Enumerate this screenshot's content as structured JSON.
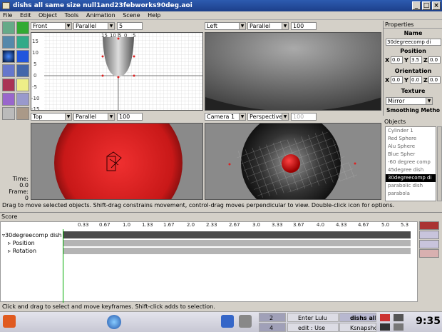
{
  "window": {
    "title": "dishs all same size null1and23febworks90deg.aoi"
  },
  "menu": [
    "File",
    "Edit",
    "Object",
    "Tools",
    "Animation",
    "Scene",
    "Help"
  ],
  "views": [
    {
      "name": "Front",
      "mode": "Parallel",
      "zoom": "5"
    },
    {
      "name": "Left",
      "mode": "Parallel",
      "zoom": "100"
    },
    {
      "name": "Top",
      "mode": "Parallel",
      "zoom": "100"
    },
    {
      "name": "Camera 1",
      "mode": "Perspective",
      "zoom": "100"
    }
  ],
  "ruler": {
    "top": [
      "15",
      "10",
      "5",
      "0",
      "5"
    ],
    "left": [
      "15",
      "10",
      "5",
      "0",
      "-5",
      "-10",
      "-15"
    ]
  },
  "time": {
    "time_label": "Time:",
    "time_value": "0.0",
    "frame_label": "Frame:",
    "frame_value": "0"
  },
  "properties": {
    "title": "Properties",
    "name_label": "Name",
    "name_value": "30degreecomp di",
    "position_label": "Position",
    "position": {
      "x": "0.0",
      "y": "3.5",
      "z": "0.0"
    },
    "orientation_label": "Orientation",
    "orientation": {
      "x": "0.0",
      "y": "0.0",
      "z": "0.0"
    },
    "texture_label": "Texture",
    "texture_value": "Mirror",
    "smoothing_label": "Smoothing Metho"
  },
  "objects": {
    "title": "Objects",
    "items": [
      "Cylinder 1",
      "Red Sphere",
      "Alu Sphere",
      "Blue Spher",
      "-60 degree comp",
      "45degree dish",
      "30degreecomp di",
      "parabolic dish",
      "parabola"
    ],
    "selected_index": 6
  },
  "status": "Drag to move selected objects.  Shift-drag constrains movement, control-drag moves perpendicular to view.  Double-click icon for options.",
  "score": {
    "title": "Score",
    "ticks": [
      "0.33",
      "0.67",
      "1.0",
      "1.33",
      "1.67",
      "2.0",
      "2.33",
      "2.67",
      "3.0",
      "3.33",
      "3.67",
      "4.0",
      "4.33",
      "4.67",
      "5.0",
      "5.3"
    ],
    "tracks": [
      "30degreecomp dish",
      "Position",
      "Rotation"
    ]
  },
  "footer": "Click and drag to select and move keyframes.  Shift-click adds to selection.",
  "taskbar": {
    "desktops": [
      "2",
      "4"
    ],
    "tasks": [
      "Enter Lulu",
      "dishs all",
      "edit : Use",
      "Ksnapsho"
    ],
    "clock": "9:35"
  },
  "colors": {
    "accent": "#2d5bb0",
    "sphere_red": "#d42020",
    "viewport_gray": "#7a7a7a"
  }
}
